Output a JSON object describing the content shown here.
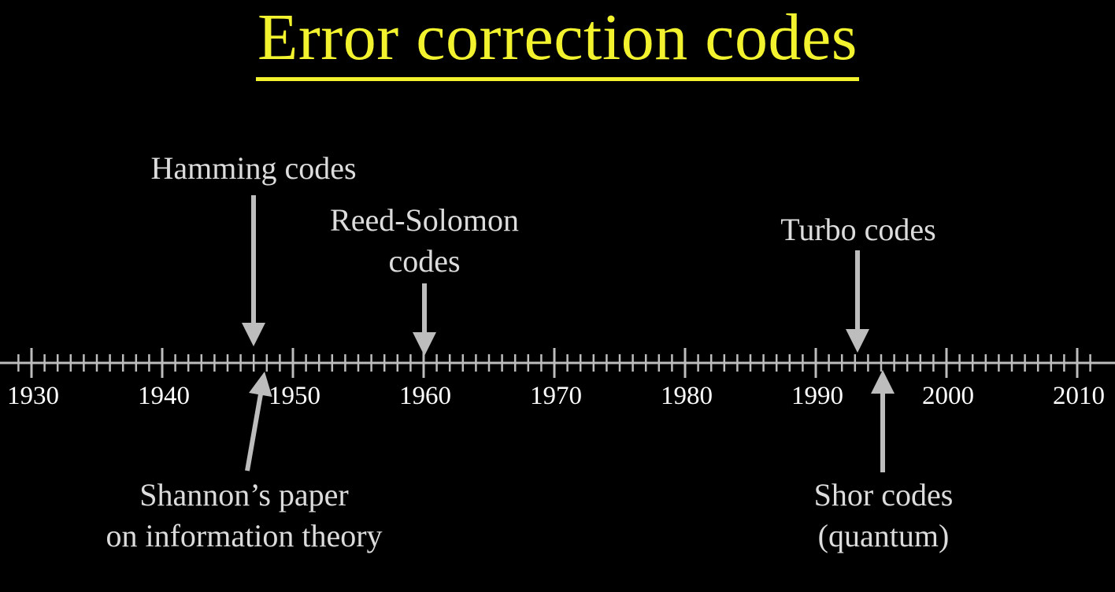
{
  "title": "Error correction codes",
  "colors": {
    "background": "#000000",
    "title": "#f2f22e",
    "axis": "#bdbdbd",
    "arrow": "#bdbdbd",
    "label": "#dcdcdc"
  },
  "timeline": {
    "start_year": 1929,
    "end_year": 2011,
    "minor_tick_step": 2,
    "major_tick_step": 10,
    "year_labels": [
      "1930",
      "1940",
      "1950",
      "1960",
      "1970",
      "1980",
      "1990",
      "2000",
      "2010"
    ]
  },
  "events": [
    {
      "id": "hamming",
      "year": 1947,
      "position": "above",
      "lines": [
        "Hamming codes"
      ]
    },
    {
      "id": "reed-solomon",
      "year": 1960,
      "position": "above",
      "lines": [
        "Reed-Solomon",
        "codes"
      ]
    },
    {
      "id": "turbo",
      "year": 1993,
      "position": "above",
      "lines": [
        "Turbo codes"
      ]
    },
    {
      "id": "shannon",
      "year": 1948,
      "position": "below",
      "lines": [
        "Shannon’s paper",
        "on information theory"
      ]
    },
    {
      "id": "shor",
      "year": 1995,
      "position": "below",
      "lines": [
        "Shor codes",
        "(quantum)"
      ]
    }
  ]
}
